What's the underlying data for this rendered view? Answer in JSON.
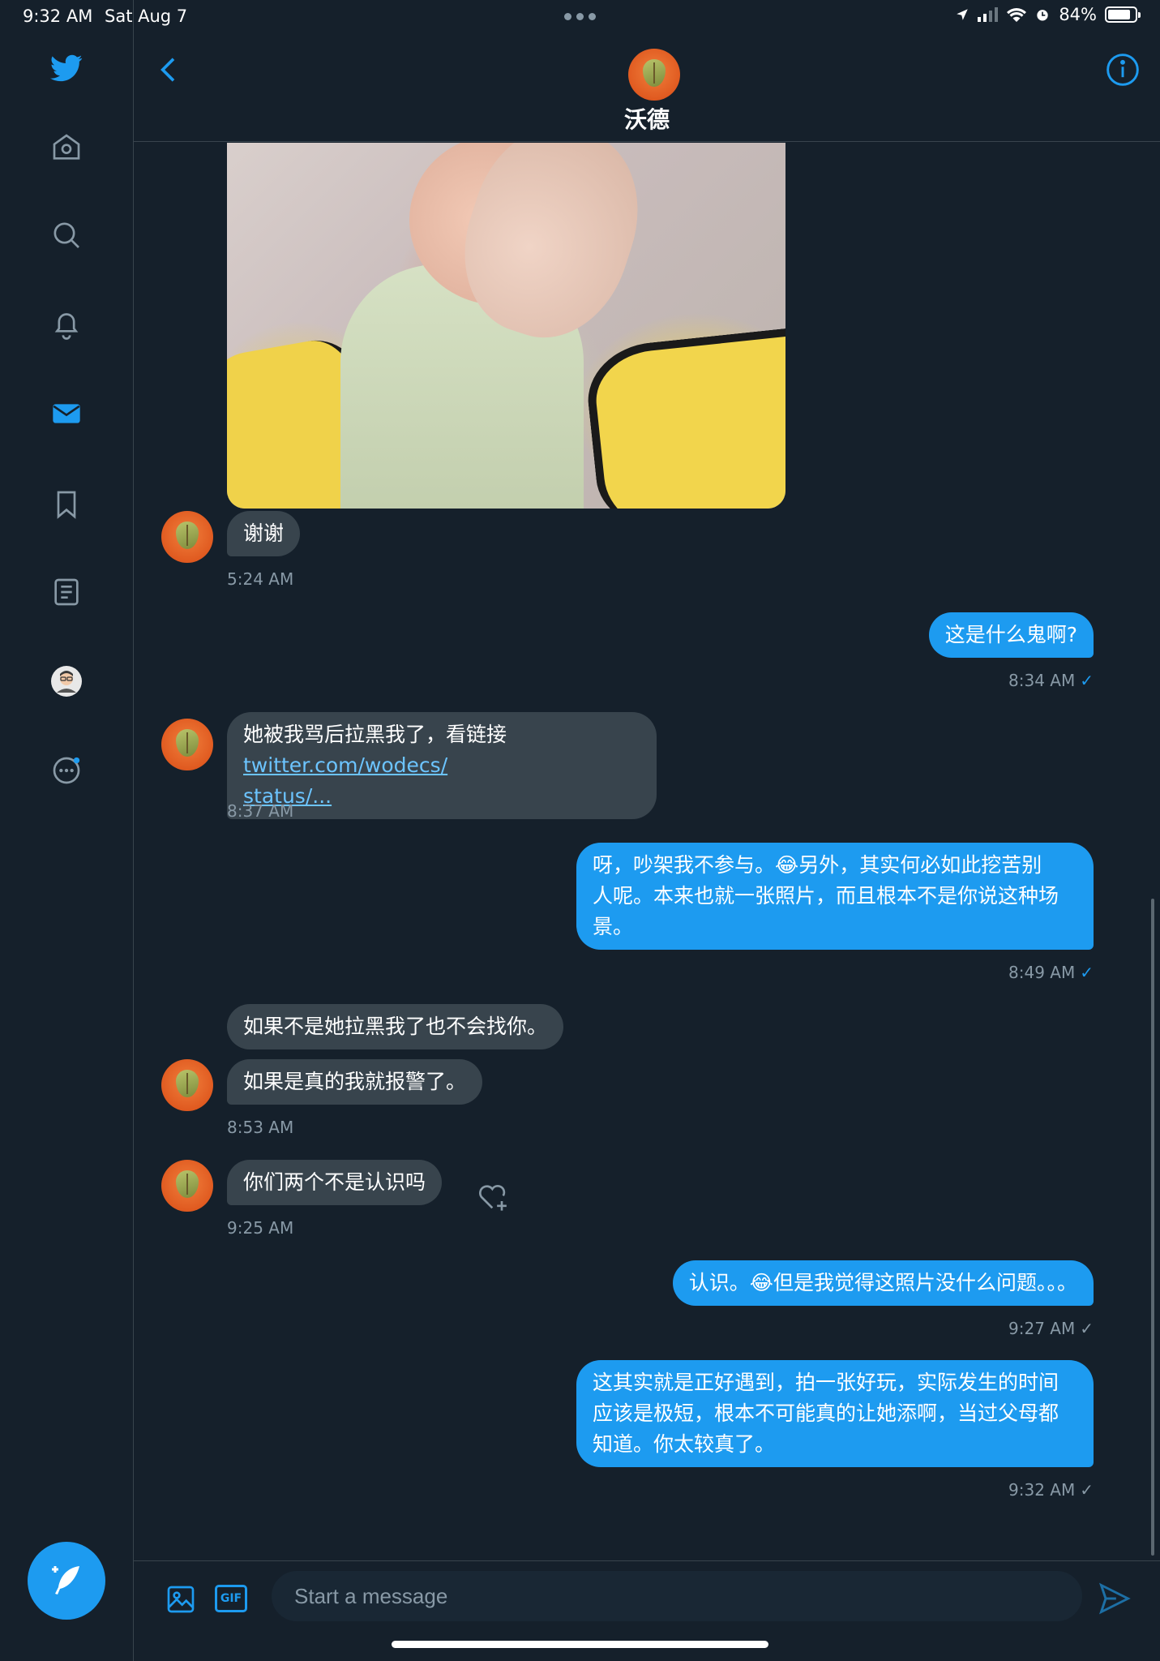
{
  "status_bar": {
    "time": "9:32 AM",
    "date": "Sat Aug 7",
    "battery": "84%"
  },
  "header": {
    "name": "沃德"
  },
  "messages": [
    {
      "text": "谢谢",
      "time": "5:24 AM"
    },
    {
      "text": "这是什么鬼啊?",
      "time": "8:34 AM"
    },
    {
      "text_before": "她被我骂后拉黑我了，看链接 ",
      "link_line1": "twitter.com/wodecs/",
      "link_line2": "status/...",
      "time": "8:37 AM"
    },
    {
      "text": "呀，吵架我不参与。😂另外，其实何必如此挖苦别人呢。本来也就一张照片，而且根本不是你说这种场景。",
      "line1": "呀，吵架我不参与。😂另外，其实何必如此挖苦别",
      "line2": "人呢。本来也就一张照片，而且根本不是你说这种场",
      "line3": "景。",
      "time": "8:49 AM"
    },
    {
      "text": "如果不是她拉黑我了也不会找你。"
    },
    {
      "text": "如果是真的我就报警了。",
      "time": "8:53 AM"
    },
    {
      "text": "你们两个不是认识吗",
      "time": "9:25 AM"
    },
    {
      "text": "认识。😂但是我觉得这照片没什么问题。。。",
      "time": "9:27 AM"
    },
    {
      "line1": "这其实就是正好遇到，拍一张好玩，实际发生的时间",
      "line2": "应该是极短，根本不可能真的让她添啊，当过父母都",
      "line3": "知道。你太较真了。",
      "time": "9:32 AM"
    }
  ],
  "composer": {
    "placeholder": "Start a message",
    "gif_label": "GIF"
  },
  "colors": {
    "background": "#15202b",
    "accent": "#1d9bf0",
    "incoming_bubble": "#38444d",
    "muted_text": "#8899a6"
  },
  "icons": [
    "twitter-logo-icon",
    "home-icon",
    "search-icon",
    "bell-icon",
    "mail-icon",
    "bookmark-icon",
    "lists-icon",
    "profile-avatar",
    "more-icon",
    "compose-icon",
    "back-icon",
    "info-icon",
    "image-icon",
    "gif-icon",
    "send-icon",
    "heart-add-icon"
  ]
}
